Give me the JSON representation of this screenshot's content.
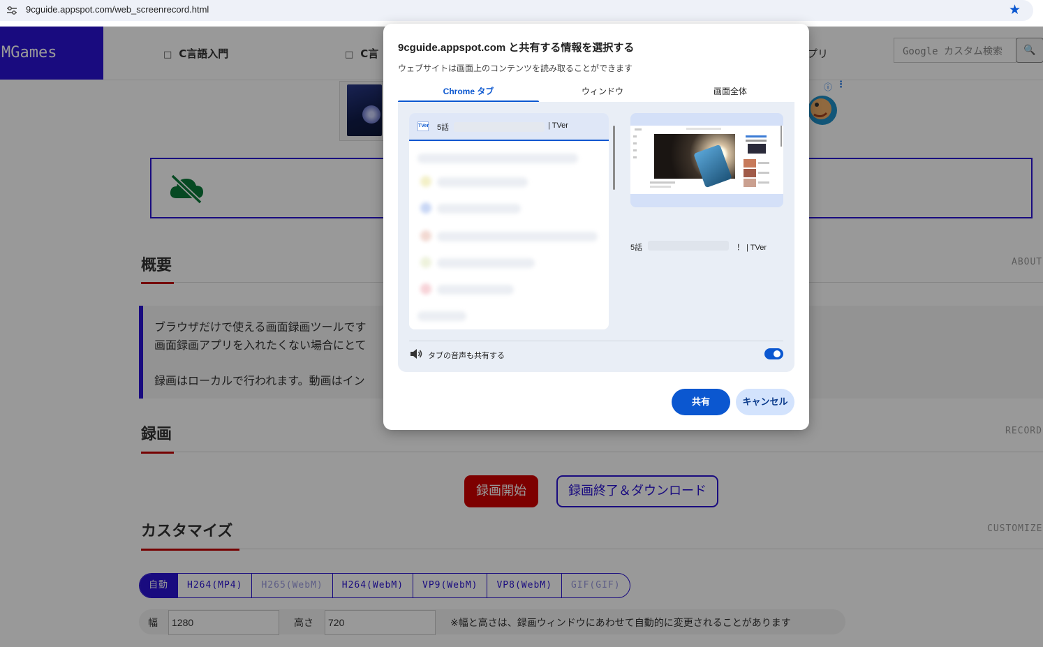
{
  "browser": {
    "url": "9cguide.appspot.com/web_screenrecord.html",
    "site_info_icon": "tune-icon",
    "bookmark_icon": "star-icon",
    "accent": "#0b57d0"
  },
  "site": {
    "logo": "MGames",
    "nav": [
      {
        "label": "C言語入門",
        "icon": "book-icon"
      },
      {
        "label": "C言",
        "icon": "book-icon"
      },
      {
        "label": "プリ"
      }
    ],
    "search_placeholder": "Google カスタム検索",
    "search_icon": "search-icon",
    "brand_color": "#2a13d4",
    "accent_red": "#c40000",
    "sections": {
      "about": {
        "title": "概要",
        "en": "ABOUT"
      },
      "record": {
        "title": "録画",
        "en": "RECORD"
      },
      "customize": {
        "title": "カスタマイズ",
        "en": "CUSTOMIZE"
      }
    },
    "about_lines": [
      "ブラウザだけで使える画面録画ツールです",
      "画面録画アプリを入れたくない場合にとて",
      "録画はローカルで行われます。動画はイン"
    ],
    "record_start": "録画開始",
    "record_stop": "録画終了＆ダウンロード",
    "formats": [
      {
        "label": "自動",
        "selected": true
      },
      {
        "label": "H264(MP4)"
      },
      {
        "label": "H265(WebM)",
        "disabled": true
      },
      {
        "label": "H264(WebM)"
      },
      {
        "label": "VP9(WebM)"
      },
      {
        "label": "VP8(WebM)"
      },
      {
        "label": "GIF(GIF)",
        "disabled": true
      }
    ],
    "width_label": "幅",
    "width_value": "1280",
    "height_label": "高さ",
    "height_value": "720",
    "size_note": "※幅と高さは、録画ウィンドウにあわせて自動的に変更されることがあります"
  },
  "dialog": {
    "title": "9cguide.appspot.com と共有する情報を選択する",
    "subtitle": "ウェブサイトは画面上のコンテンツを読み取ることができます",
    "tabs": [
      {
        "label": "Chrome タブ",
        "active": true
      },
      {
        "label": "ウィンドウ"
      },
      {
        "label": "画面全体"
      }
    ],
    "selected_tab": {
      "favicon": "TVer",
      "title_start": "5話",
      "title_end": "| TVer"
    },
    "preview_caption_start": "5話",
    "preview_caption_end": "！ | TVer",
    "audio_label": "タブの音声も共有する",
    "audio_icon": "speaker-icon",
    "audio_share_on": true,
    "share_button": "共有",
    "cancel_button": "キャンセル"
  }
}
